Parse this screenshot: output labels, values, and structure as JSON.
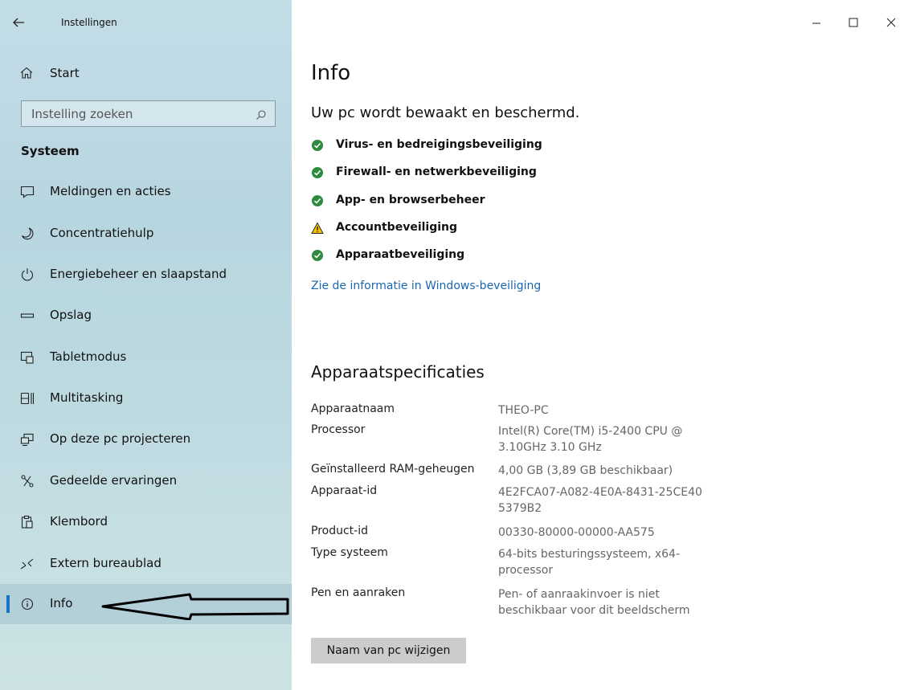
{
  "window": {
    "title": "Instellingen",
    "controls": [
      "minimize",
      "maximize",
      "close"
    ]
  },
  "sidebar": {
    "home_label": "Start",
    "search_placeholder": "Instelling zoeken",
    "section": "Systeem",
    "items": [
      {
        "label": "Meldingen en acties",
        "icon": "notification-icon"
      },
      {
        "label": "Concentratiehulp",
        "icon": "moon-icon"
      },
      {
        "label": "Energiebeheer en slaapstand",
        "icon": "power-icon"
      },
      {
        "label": "Opslag",
        "icon": "storage-icon"
      },
      {
        "label": "Tabletmodus",
        "icon": "tablet-icon"
      },
      {
        "label": "Multitasking",
        "icon": "multitasking-icon"
      },
      {
        "label": "Op deze pc projecteren",
        "icon": "project-icon"
      },
      {
        "label": "Gedeelde ervaringen",
        "icon": "shared-icon"
      },
      {
        "label": "Klembord",
        "icon": "clipboard-icon"
      },
      {
        "label": "Extern bureaublad",
        "icon": "remote-icon"
      },
      {
        "label": "Info",
        "icon": "info-icon",
        "active": true
      }
    ]
  },
  "main": {
    "title": "Info",
    "protection_status": "Uw pc wordt bewaakt en beschermd.",
    "security_items": [
      {
        "label": "Virus- en bedreigingsbeveiliging",
        "status": "ok"
      },
      {
        "label": "Firewall- en netwerkbeveiliging",
        "status": "ok"
      },
      {
        "label": "App- en browserbeheer",
        "status": "ok"
      },
      {
        "label": "Accountbeveiliging",
        "status": "warning"
      },
      {
        "label": "Apparaatbeveiliging",
        "status": "ok"
      }
    ],
    "security_link": "Zie de informatie in Windows-beveiliging",
    "specs_title": "Apparaatspecificaties",
    "specs": [
      {
        "key": "Apparaatnaam",
        "value": "THEO-PC"
      },
      {
        "key": "Processor",
        "value": "Intel(R) Core(TM) i5-2400 CPU @ 3.10GHz   3.10 GHz"
      },
      {
        "key": "Geïnstalleerd RAM-geheugen",
        "value": "4,00 GB (3,89 GB beschikbaar)"
      },
      {
        "key": "Apparaat-id",
        "value": "4E2FCA07-A082-4E0A-8431-25CE405379B2"
      },
      {
        "key": "Product-id",
        "value": "00330-80000-00000-AA575"
      },
      {
        "key": "Type systeem",
        "value": "64-bits besturingssysteem, x64-processor"
      },
      {
        "key": "Pen en aanraken",
        "value": "Pen- of aanraakinvoer is niet beschikbaar voor dit beeldscherm"
      }
    ],
    "rename_button": "Naam van pc wijzigen"
  },
  "colors": {
    "accent": "#1a73c8",
    "link": "#1a67b0",
    "ok": "#2e8b3e",
    "warning": "#f2c200"
  }
}
